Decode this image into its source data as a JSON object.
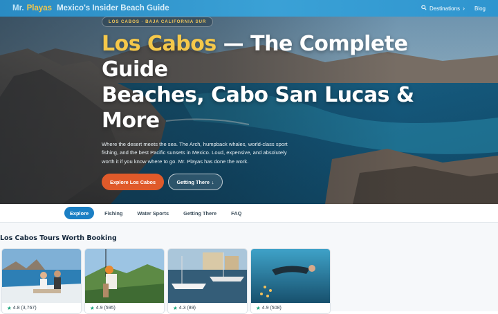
{
  "nav": {
    "brand_mr": "Mr.",
    "brand_playas": "Playas",
    "brand_tagline": "Mexico's Insider Beach Guide",
    "destinations_label": "Destinations",
    "blog_label": "Blog"
  },
  "hero": {
    "pill": "LOS CABOS · BAJA CALIFORNIA SUR",
    "headline_gold": "Los Cabos",
    "headline_line1_rest": " — The Complete",
    "headline_line2": "Guide",
    "headline_line3": "Beaches, Cabo San Lucas &",
    "headline_line4": "More",
    "lede": "Where the desert meets the sea. The Arch, humpback whales, world-class sport fishing, and the best Pacific sunsets in Mexico. Loud, expensive, and absolutely worth it if you know where to go. Mr. Playas has done the work.",
    "primary_button": "Explore Los Cabos",
    "secondary_button": "Getting There",
    "secondary_arrow": "↓"
  },
  "tabs": [
    {
      "label": "Explore",
      "active": true
    },
    {
      "label": "Fishing",
      "active": false
    },
    {
      "label": "Water Sports",
      "active": false
    },
    {
      "label": "Getting There",
      "active": false
    },
    {
      "label": "FAQ",
      "active": false
    }
  ],
  "tours": {
    "title": "Los Cabos Tours Worth Booking",
    "cards": [
      {
        "image": "boat-couple-arch-photo",
        "rating": "4.8",
        "reviews": "(3,767)"
      },
      {
        "image": "zipline-photo",
        "rating": "4.9",
        "reviews": "(595)"
      },
      {
        "image": "marina-boats-photo",
        "rating": "4.3",
        "reviews": "(89)"
      },
      {
        "image": "snorkel-underwater-photo",
        "rating": "4.9",
        "reviews": "(508)"
      }
    ]
  },
  "colors": {
    "nav_bg": "#3aa1d6",
    "brand_gold": "#f5c84a",
    "primary_button": "#e05a2a",
    "active_tab": "#1b7fc4",
    "rating_star": "#1aa37a"
  },
  "icons": {
    "search": "search-icon",
    "chevron": "chevron-right-icon",
    "star": "star-icon",
    "arrow_down": "arrow-down-icon"
  }
}
